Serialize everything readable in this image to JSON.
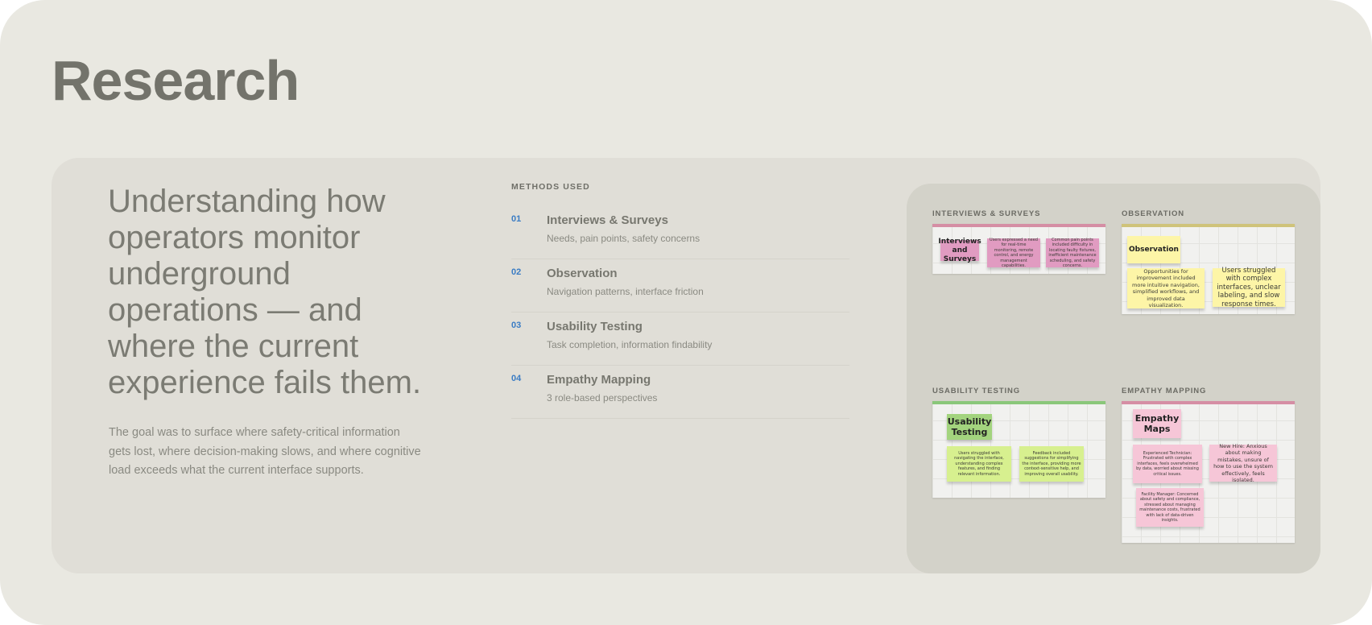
{
  "page": {
    "title": "Research"
  },
  "intro": {
    "headline": "Understanding how operators monitor underground operations — and where the current experience fails them.",
    "lede": "The goal was to surface where safety-critical information gets lost, where decision-making slows, and where cognitive load exceeds what the current interface supports."
  },
  "methods": {
    "label": "METHODS USED",
    "items": [
      {
        "num": "01",
        "name": "Interviews & Surveys",
        "desc": "Needs, pain points, safety concerns"
      },
      {
        "num": "02",
        "name": "Observation",
        "desc": "Navigation patterns, interface friction"
      },
      {
        "num": "03",
        "name": "Usability Testing",
        "desc": "Task completion, information findability"
      },
      {
        "num": "04",
        "name": "Empathy Mapping",
        "desc": "3 role-based perspectives"
      }
    ]
  },
  "boards": {
    "interviews": {
      "label": "INTERVIEWS & SURVEYS",
      "accent": "#d58ea4",
      "notes": [
        "Interviews and Surveys",
        "Users expressed a need for real-time monitoring, remote control, and energy management capabilities.",
        "Common pain points included difficulty in locating faulty fixtures, inefficient maintenance scheduling, and safety concerns."
      ]
    },
    "observation": {
      "label": "OBSERVATION",
      "accent": "#cfc37a",
      "notes": [
        "Observation",
        "Opportunities for improvement included more intuitive navigation, simplified workflows, and improved data visualization.",
        "Users struggled with complex interfaces, unclear labeling, and slow response times."
      ]
    },
    "usability": {
      "label": "USABILITY TESTING",
      "accent": "#8ac77a",
      "notes": [
        "Usability Testing",
        "Users struggled with navigating the interface, understanding complex features, and finding relevant information.",
        "Feedback included suggestions for simplifying the interface, providing more context-sensitive help, and improving overall usability."
      ]
    },
    "empathy": {
      "label": "EMPATHY MAPPING",
      "accent": "#d58ea4",
      "notes": [
        "Empathy Maps",
        "Experienced Technician: Frustrated with complex interfaces, feels overwhelmed by data, worried about missing critical issues.",
        "New Hire: Anxious about making mistakes, unsure of how to use the system effectively, feels isolated.",
        "Facility Manager: Concerned about safety and compliance, stressed about managing maintenance costs, frustrated with lack of data-driven insights."
      ]
    }
  }
}
